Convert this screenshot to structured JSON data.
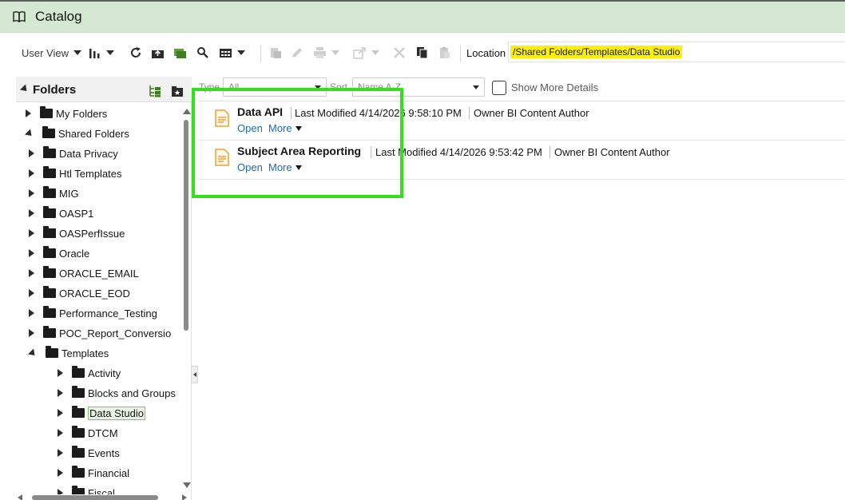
{
  "window": {
    "title": "Catalog",
    "icon": "book-icon"
  },
  "toolbar": {
    "view_label": "User View",
    "icons": [
      "sort-icon",
      "refresh-icon",
      "upload-icon",
      "new-folder-icon",
      "search-icon",
      "view-grid-icon",
      "archive-icon",
      "edit-icon",
      "print-icon",
      "share-icon",
      "delete-icon",
      "copy-icon",
      "paste-icon"
    ],
    "location_label": "Location",
    "location_value": "/Shared Folders/Templates/Data Studio"
  },
  "folders": {
    "title": "Folders",
    "tree": [
      {
        "label": "My Folders",
        "level": 0,
        "expanded": false
      },
      {
        "label": "Shared Folders",
        "level": 0,
        "expanded": true
      },
      {
        "label": "Data Privacy",
        "level": 1,
        "expanded": false
      },
      {
        "label": "Htl Templates",
        "level": 1,
        "expanded": false
      },
      {
        "label": "MIG",
        "level": 1,
        "expanded": false
      },
      {
        "label": "OASP1",
        "level": 1,
        "expanded": false
      },
      {
        "label": "OASPerfIssue",
        "level": 1,
        "expanded": false
      },
      {
        "label": "Oracle",
        "level": 1,
        "expanded": false
      },
      {
        "label": "ORACLE_EMAIL",
        "level": 1,
        "expanded": false
      },
      {
        "label": "ORACLE_EOD",
        "level": 1,
        "expanded": false
      },
      {
        "label": "Performance_Testing",
        "level": 1,
        "expanded": false
      },
      {
        "label": "POC_Report_Conversio",
        "level": 1,
        "expanded": false
      },
      {
        "label": "Templates",
        "level": 1,
        "expanded": true
      },
      {
        "label": "Activity",
        "level": 2,
        "expanded": false
      },
      {
        "label": "Blocks and Groups",
        "level": 2,
        "expanded": false
      },
      {
        "label": "Data Studio",
        "level": 2,
        "expanded": false,
        "selected": true
      },
      {
        "label": "DTCM",
        "level": 2,
        "expanded": false
      },
      {
        "label": "Events",
        "level": 2,
        "expanded": false
      },
      {
        "label": "Financial",
        "level": 2,
        "expanded": false
      },
      {
        "label": "Fiscal",
        "level": 2,
        "expanded": false
      }
    ]
  },
  "filters": {
    "type_label": "Type",
    "type_value": "All",
    "sort_label": "Sort",
    "sort_value": "Name A-Z",
    "show_more_label": "Show More Details"
  },
  "items": [
    {
      "name": "Data API",
      "modified": "Last Modified 4/14/2026 9:58:10 PM",
      "owner": "Owner BI Content Author",
      "open_label": "Open",
      "more_label": "More"
    },
    {
      "name": "Subject Area Reporting",
      "modified": "Last Modified 4/14/2026 9:53:42 PM",
      "owner": "Owner BI Content Author",
      "open_label": "Open",
      "more_label": "More"
    }
  ],
  "colors": {
    "header_bg": "#d5e8d2",
    "highlight": "#33e01b",
    "link": "#1a6bb3",
    "doc_icon": "#f0a030",
    "location_highlight": "#fff200"
  }
}
